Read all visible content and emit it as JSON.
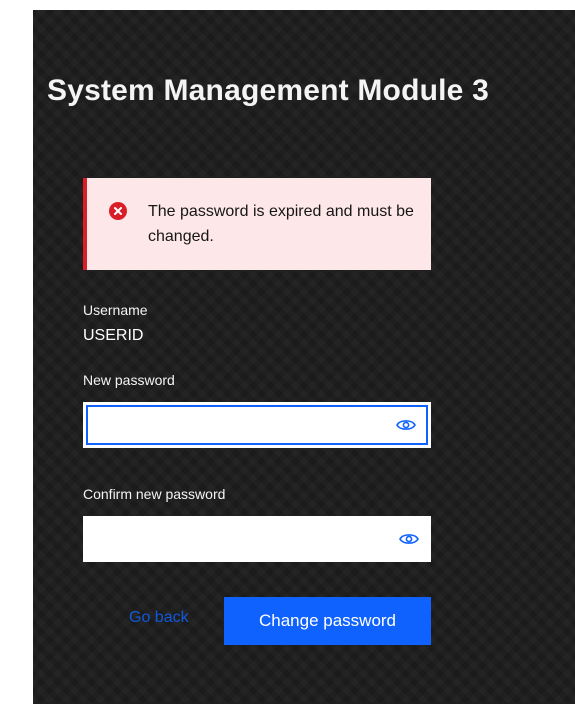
{
  "title": "System Management Module 3",
  "alert": {
    "message": "The password is expired and must be changed.",
    "icon": "error-icon",
    "color": "#da1e28",
    "background": "#fde7e9"
  },
  "username": {
    "label": "Username",
    "value": "USERID"
  },
  "new_password": {
    "label": "New password",
    "value": "",
    "icon": "eye-icon"
  },
  "confirm_password": {
    "label": "Confirm new password",
    "value": "",
    "icon": "eye-icon"
  },
  "actions": {
    "go_back_label": "Go back",
    "submit_label": "Change password"
  },
  "colors": {
    "accent": "#0f62fe",
    "background": "#1b1b1b"
  }
}
